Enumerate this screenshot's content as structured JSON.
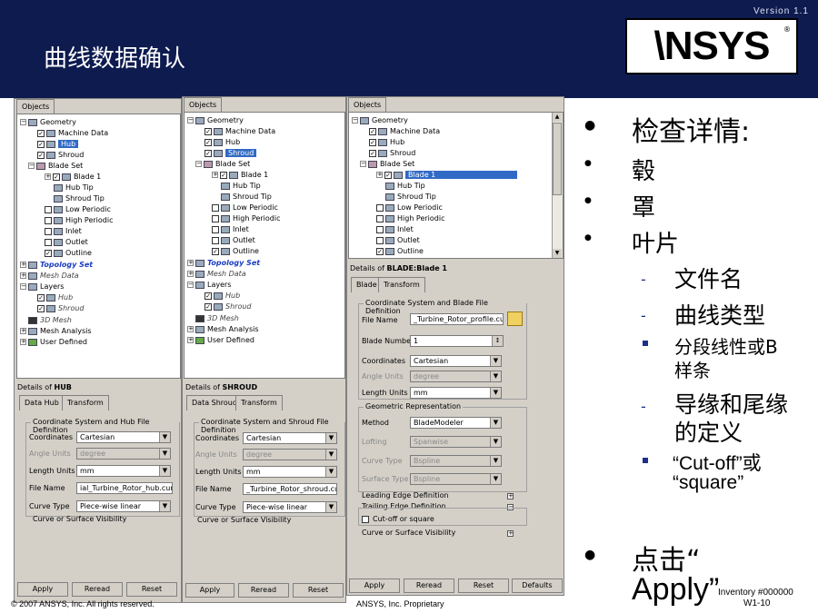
{
  "slide": {
    "title": "曲线数据确认",
    "version": "Version 1.1",
    "logo_a": "\\NSYS",
    "logo_b": "",
    "logo_r": "®",
    "footer_left": "© 2007 ANSYS, Inc.  All rights reserved.",
    "footer_mid": "ANSYS, Inc. Proprietary",
    "footer_inv": "Inventory #000000",
    "footer_page": "W1-10"
  },
  "panel1": {
    "tab": "Objects",
    "tree": [
      "Geometry",
      "Machine Data",
      "Hub",
      "Shroud",
      "Blade Set",
      "Blade 1",
      "Hub Tip",
      "Shroud Tip",
      "Low Periodic",
      "High Periodic",
      "Inlet",
      "Outlet",
      "Outline",
      "Topology Set",
      "Mesh Data",
      "Layers",
      "Hub",
      "Shroud",
      "3D Mesh",
      "Mesh Analysis",
      "User Defined"
    ],
    "details_prefix": "Details of ",
    "details_name": "HUB",
    "tab_a": "Data Hub",
    "tab_b": "Transform",
    "group": "Coordinate System and Hub File Definition",
    "f1": "Coordinates",
    "v1": "Cartesian",
    "f2": "Angle Units",
    "v2": "degree",
    "f3": "Length Units",
    "v3": "mm",
    "f4": "File Name",
    "v4": "ial_Turbine_Rotor_hub.curve",
    "f5": "Curve Type",
    "v5": "Piece-wise linear",
    "collapsed": "Curve or Surface Visibility",
    "b1": "Apply",
    "b2": "Reread",
    "b3": "Reset"
  },
  "panel2": {
    "tab": "Objects",
    "tree": [
      "Geometry",
      "Machine Data",
      "Hub",
      "Shroud",
      "Blade Set",
      "Blade 1",
      "Hub Tip",
      "Shroud Tip",
      "Low Periodic",
      "High Periodic",
      "Inlet",
      "Outlet",
      "Outline",
      "Topology Set",
      "Mesh Data",
      "Layers",
      "Hub",
      "Shroud",
      "3D Mesh",
      "Mesh Analysis",
      "User Defined"
    ],
    "details_prefix": "Details of ",
    "details_name": "SHROUD",
    "tab_a": "Data Shroud",
    "tab_b": "Transform",
    "group": "Coordinate System and Shroud File Definition",
    "f1": "Coordinates",
    "v1": "Cartesian",
    "f2": "Angle Units",
    "v2": "degree",
    "f3": "Length Units",
    "v3": "mm",
    "f4": "File Name",
    "v4": "_Turbine_Rotor_shroud.curve",
    "f5": "Curve Type",
    "v5": "Piece-wise linear",
    "collapsed": "Curve or Surface Visibility",
    "b1": "Apply",
    "b2": "Reread",
    "b3": "Reset"
  },
  "panel3": {
    "tab": "Objects",
    "tree": [
      "Geometry",
      "Machine Data",
      "Hub",
      "Shroud",
      "Blade Set",
      "Blade 1",
      "Hub Tip",
      "Shroud Tip",
      "Low Periodic",
      "High Periodic",
      "Inlet",
      "Outlet",
      "Outline"
    ],
    "details_prefix": "Details of ",
    "details_name": "BLADE:Blade 1",
    "tab_a": "Blade",
    "tab_b": "Transform",
    "group1": "Coordinate System and Blade File Definition",
    "file_label": "File Name",
    "file_value": "_Turbine_Rotor_profile.curve",
    "bn_label": "Blade Number",
    "bn_value": "1",
    "coord_label": "Coordinates",
    "coord_value": "Cartesian",
    "ang_label": "Angle Units",
    "ang_value": "degree",
    "len_label": "Length Units",
    "len_value": "mm",
    "group2": "Geometric Representation",
    "meth_label": "Method",
    "meth_value": "BladeModeler",
    "loft_label": "Lofting",
    "loft_value": "Spanwise",
    "ct_label": "Curve Type",
    "ct_value": "Bspline",
    "st_label": "Surface Type",
    "st_value": "Bspline",
    "le": "Leading Edge Definition",
    "te": "Trailing Edge Definition",
    "cutoff": "Cut-off or square",
    "vis": "Curve or Surface Visibility",
    "b1": "Apply",
    "b2": "Reread",
    "b3": "Reset",
    "b4": "Defaults"
  },
  "bullets": {
    "b1": "检查详情:",
    "b2": "毂",
    "b3": "罩",
    "b4": "叶片",
    "s1": "文件名",
    "s2": "曲线类型",
    "s3a": "分段线性或B",
    "s3b": "样条",
    "s4a": "导缘和尾缘",
    "s4b": "的定义",
    "s5a": "“Cut-off”或",
    "s5b": "“square”",
    "b5a": "点击“",
    "b5b": "Apply”"
  }
}
